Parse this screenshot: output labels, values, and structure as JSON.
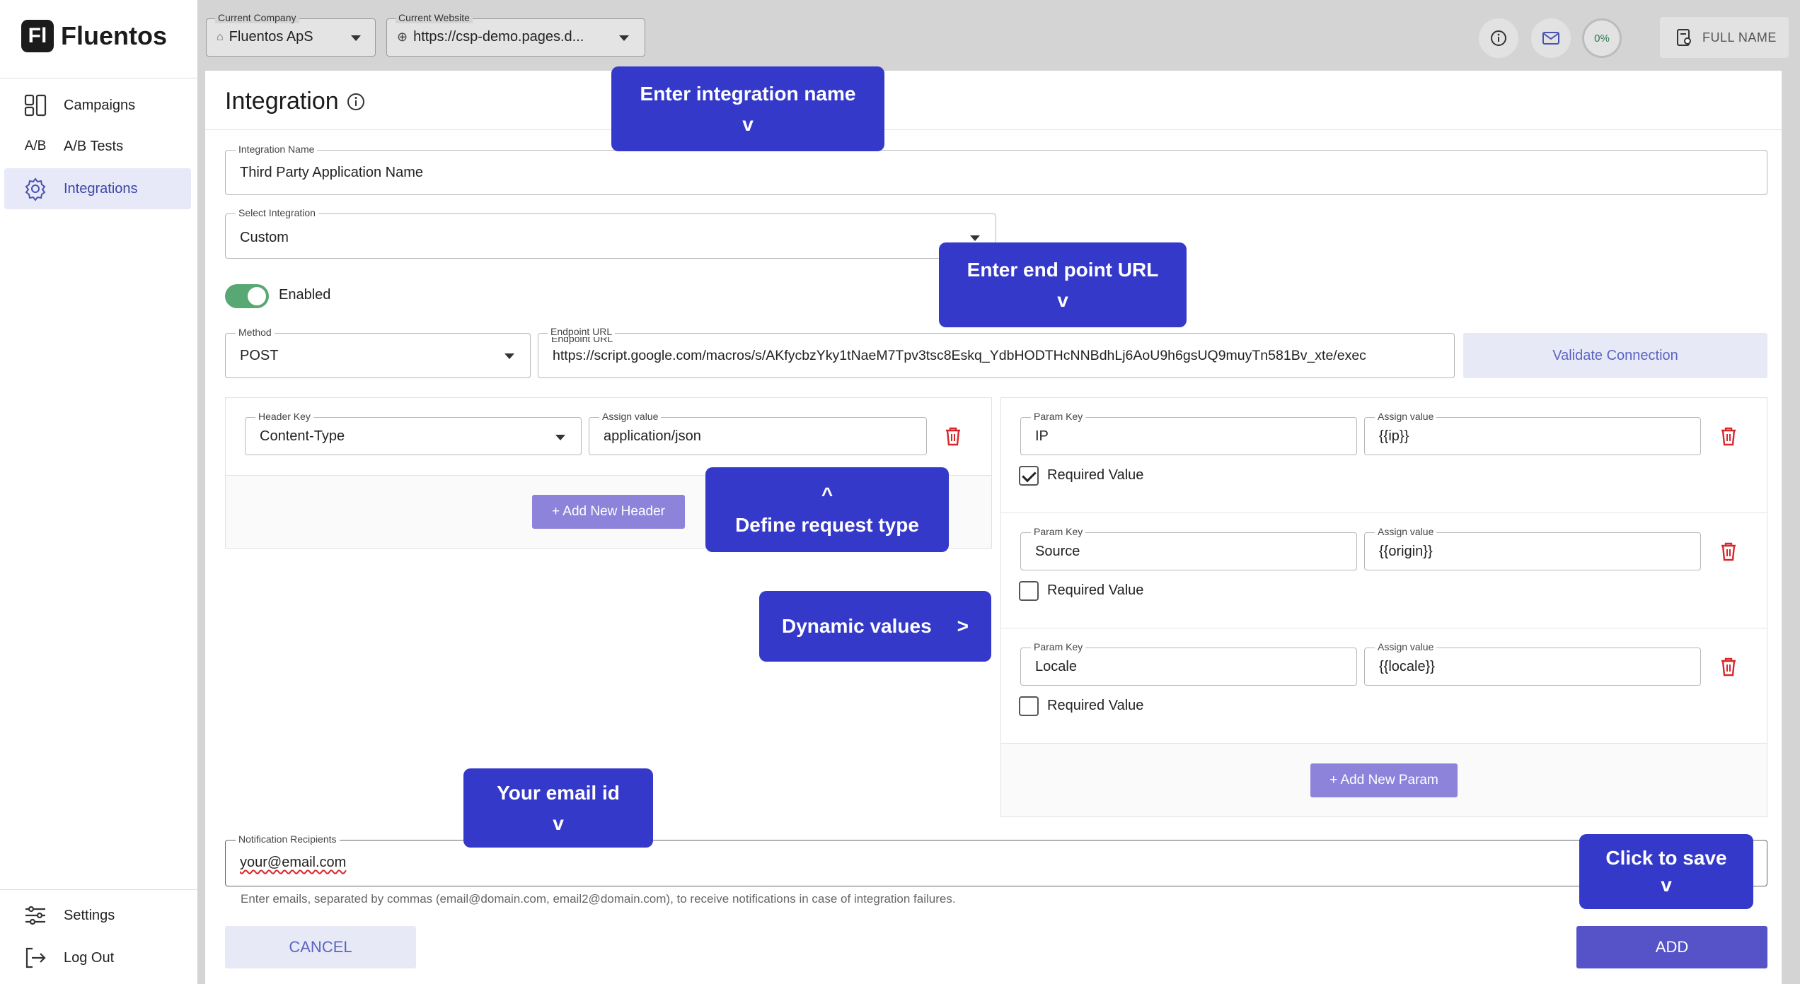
{
  "app": {
    "brand": "Fluentos",
    "brand_mark": "Fl"
  },
  "sidebar": {
    "items": [
      {
        "label": "Campaigns",
        "icon": "campaigns-icon"
      },
      {
        "label": "A/B Tests",
        "icon_text": "A/B"
      },
      {
        "label": "Integrations",
        "icon": "gear-icon",
        "active": true
      }
    ],
    "bottom_items": [
      {
        "label": "Settings",
        "icon": "sliders-icon"
      },
      {
        "label": "Log Out",
        "icon": "logout-icon"
      }
    ]
  },
  "topbar": {
    "company_label": "Current Company",
    "company_value": "Fluentos ApS",
    "website_label": "Current Website",
    "website_value": "https://csp-demo.pages.d...",
    "progress": "0%",
    "user_name": "FULL NAME"
  },
  "page": {
    "title": "Integration"
  },
  "form": {
    "integration_name_label": "Integration Name",
    "integration_name_value": "Third Party Application Name",
    "select_integration_label": "Select Integration",
    "select_integration_value": "Custom",
    "enabled_label": "Enabled",
    "enabled": true,
    "method_label": "Method",
    "method_value": "POST",
    "endpoint_label": "Endpoint URL",
    "endpoint_value": "https://script.google.com/macros/s/AKfycbzYky1tNaeM7Tpv3tsc8Eskq_YdbHODTHcNNBdhLj6AoU9h6gsUQ9muyTn581Bv_xte/exec",
    "validate_label": "Validate Connection"
  },
  "headers": {
    "key_label": "Header Key",
    "value_label": "Assign value",
    "rows": [
      {
        "key": "Content-Type",
        "value": "application/json"
      }
    ],
    "add_label": "+ Add New Header"
  },
  "params": {
    "key_label": "Param Key",
    "value_label": "Assign value",
    "required_label": "Required Value",
    "rows": [
      {
        "key": "IP",
        "value": "{{ip}}",
        "required": true
      },
      {
        "key": "Source",
        "value": "{{origin}}",
        "required": false
      },
      {
        "key": "Locale",
        "value": "{{locale}}",
        "required": false
      }
    ],
    "add_label": "+ Add New Param"
  },
  "notifications": {
    "label": "Notification Recipients",
    "value": "your@email.com",
    "help": "Enter emails, separated by commas (email@domain.com, email2@domain.com), to receive notifications in case of integration failures."
  },
  "actions": {
    "cancel": "CANCEL",
    "add": "ADD"
  },
  "tooltips": {
    "integration_name": {
      "line1": "Enter integration name",
      "line2": "v"
    },
    "endpoint": {
      "line1": "Enter end point URL",
      "line2": "v"
    },
    "request_type": {
      "line1": "^",
      "line2": "Define request type"
    },
    "dynamic_values": {
      "text": "Dynamic values",
      "arrow": ">"
    },
    "email": {
      "line1": "Your email id",
      "line2": "v"
    },
    "save": {
      "line1": "Click to save",
      "line2": "v"
    }
  },
  "colors": {
    "accent": "#3439c9",
    "primary_button": "#5553c7",
    "toggle_on": "#57a873",
    "danger": "#d8262b"
  }
}
